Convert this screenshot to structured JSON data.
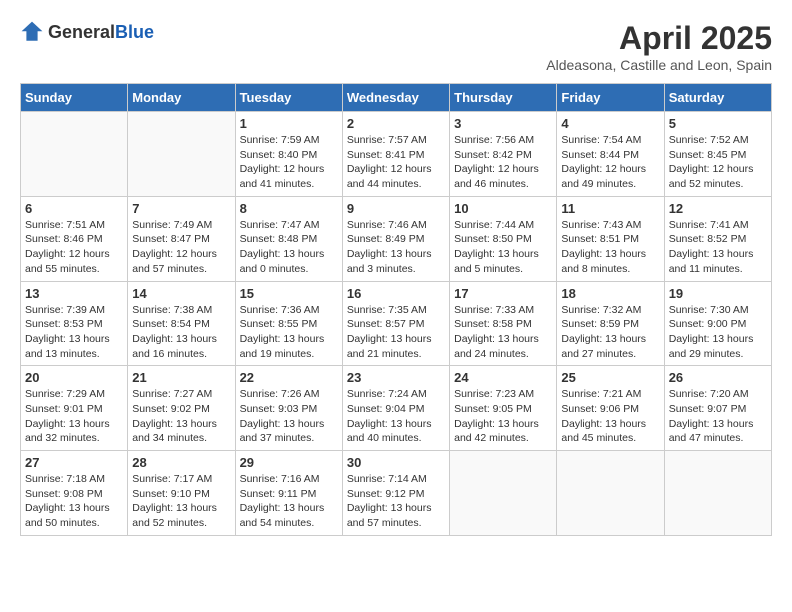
{
  "header": {
    "logo_general": "General",
    "logo_blue": "Blue",
    "month_title": "April 2025",
    "location": "Aldeasona, Castille and Leon, Spain"
  },
  "days_of_week": [
    "Sunday",
    "Monday",
    "Tuesday",
    "Wednesday",
    "Thursday",
    "Friday",
    "Saturday"
  ],
  "weeks": [
    [
      {
        "day": "",
        "empty": true
      },
      {
        "day": "",
        "empty": true
      },
      {
        "day": "1",
        "sunrise": "Sunrise: 7:59 AM",
        "sunset": "Sunset: 8:40 PM",
        "daylight": "Daylight: 12 hours and 41 minutes."
      },
      {
        "day": "2",
        "sunrise": "Sunrise: 7:57 AM",
        "sunset": "Sunset: 8:41 PM",
        "daylight": "Daylight: 12 hours and 44 minutes."
      },
      {
        "day": "3",
        "sunrise": "Sunrise: 7:56 AM",
        "sunset": "Sunset: 8:42 PM",
        "daylight": "Daylight: 12 hours and 46 minutes."
      },
      {
        "day": "4",
        "sunrise": "Sunrise: 7:54 AM",
        "sunset": "Sunset: 8:44 PM",
        "daylight": "Daylight: 12 hours and 49 minutes."
      },
      {
        "day": "5",
        "sunrise": "Sunrise: 7:52 AM",
        "sunset": "Sunset: 8:45 PM",
        "daylight": "Daylight: 12 hours and 52 minutes."
      }
    ],
    [
      {
        "day": "6",
        "sunrise": "Sunrise: 7:51 AM",
        "sunset": "Sunset: 8:46 PM",
        "daylight": "Daylight: 12 hours and 55 minutes."
      },
      {
        "day": "7",
        "sunrise": "Sunrise: 7:49 AM",
        "sunset": "Sunset: 8:47 PM",
        "daylight": "Daylight: 12 hours and 57 minutes."
      },
      {
        "day": "8",
        "sunrise": "Sunrise: 7:47 AM",
        "sunset": "Sunset: 8:48 PM",
        "daylight": "Daylight: 13 hours and 0 minutes."
      },
      {
        "day": "9",
        "sunrise": "Sunrise: 7:46 AM",
        "sunset": "Sunset: 8:49 PM",
        "daylight": "Daylight: 13 hours and 3 minutes."
      },
      {
        "day": "10",
        "sunrise": "Sunrise: 7:44 AM",
        "sunset": "Sunset: 8:50 PM",
        "daylight": "Daylight: 13 hours and 5 minutes."
      },
      {
        "day": "11",
        "sunrise": "Sunrise: 7:43 AM",
        "sunset": "Sunset: 8:51 PM",
        "daylight": "Daylight: 13 hours and 8 minutes."
      },
      {
        "day": "12",
        "sunrise": "Sunrise: 7:41 AM",
        "sunset": "Sunset: 8:52 PM",
        "daylight": "Daylight: 13 hours and 11 minutes."
      }
    ],
    [
      {
        "day": "13",
        "sunrise": "Sunrise: 7:39 AM",
        "sunset": "Sunset: 8:53 PM",
        "daylight": "Daylight: 13 hours and 13 minutes."
      },
      {
        "day": "14",
        "sunrise": "Sunrise: 7:38 AM",
        "sunset": "Sunset: 8:54 PM",
        "daylight": "Daylight: 13 hours and 16 minutes."
      },
      {
        "day": "15",
        "sunrise": "Sunrise: 7:36 AM",
        "sunset": "Sunset: 8:55 PM",
        "daylight": "Daylight: 13 hours and 19 minutes."
      },
      {
        "day": "16",
        "sunrise": "Sunrise: 7:35 AM",
        "sunset": "Sunset: 8:57 PM",
        "daylight": "Daylight: 13 hours and 21 minutes."
      },
      {
        "day": "17",
        "sunrise": "Sunrise: 7:33 AM",
        "sunset": "Sunset: 8:58 PM",
        "daylight": "Daylight: 13 hours and 24 minutes."
      },
      {
        "day": "18",
        "sunrise": "Sunrise: 7:32 AM",
        "sunset": "Sunset: 8:59 PM",
        "daylight": "Daylight: 13 hours and 27 minutes."
      },
      {
        "day": "19",
        "sunrise": "Sunrise: 7:30 AM",
        "sunset": "Sunset: 9:00 PM",
        "daylight": "Daylight: 13 hours and 29 minutes."
      }
    ],
    [
      {
        "day": "20",
        "sunrise": "Sunrise: 7:29 AM",
        "sunset": "Sunset: 9:01 PM",
        "daylight": "Daylight: 13 hours and 32 minutes."
      },
      {
        "day": "21",
        "sunrise": "Sunrise: 7:27 AM",
        "sunset": "Sunset: 9:02 PM",
        "daylight": "Daylight: 13 hours and 34 minutes."
      },
      {
        "day": "22",
        "sunrise": "Sunrise: 7:26 AM",
        "sunset": "Sunset: 9:03 PM",
        "daylight": "Daylight: 13 hours and 37 minutes."
      },
      {
        "day": "23",
        "sunrise": "Sunrise: 7:24 AM",
        "sunset": "Sunset: 9:04 PM",
        "daylight": "Daylight: 13 hours and 40 minutes."
      },
      {
        "day": "24",
        "sunrise": "Sunrise: 7:23 AM",
        "sunset": "Sunset: 9:05 PM",
        "daylight": "Daylight: 13 hours and 42 minutes."
      },
      {
        "day": "25",
        "sunrise": "Sunrise: 7:21 AM",
        "sunset": "Sunset: 9:06 PM",
        "daylight": "Daylight: 13 hours and 45 minutes."
      },
      {
        "day": "26",
        "sunrise": "Sunrise: 7:20 AM",
        "sunset": "Sunset: 9:07 PM",
        "daylight": "Daylight: 13 hours and 47 minutes."
      }
    ],
    [
      {
        "day": "27",
        "sunrise": "Sunrise: 7:18 AM",
        "sunset": "Sunset: 9:08 PM",
        "daylight": "Daylight: 13 hours and 50 minutes."
      },
      {
        "day": "28",
        "sunrise": "Sunrise: 7:17 AM",
        "sunset": "Sunset: 9:10 PM",
        "daylight": "Daylight: 13 hours and 52 minutes."
      },
      {
        "day": "29",
        "sunrise": "Sunrise: 7:16 AM",
        "sunset": "Sunset: 9:11 PM",
        "daylight": "Daylight: 13 hours and 54 minutes."
      },
      {
        "day": "30",
        "sunrise": "Sunrise: 7:14 AM",
        "sunset": "Sunset: 9:12 PM",
        "daylight": "Daylight: 13 hours and 57 minutes."
      },
      {
        "day": "",
        "empty": true
      },
      {
        "day": "",
        "empty": true
      },
      {
        "day": "",
        "empty": true
      }
    ]
  ]
}
